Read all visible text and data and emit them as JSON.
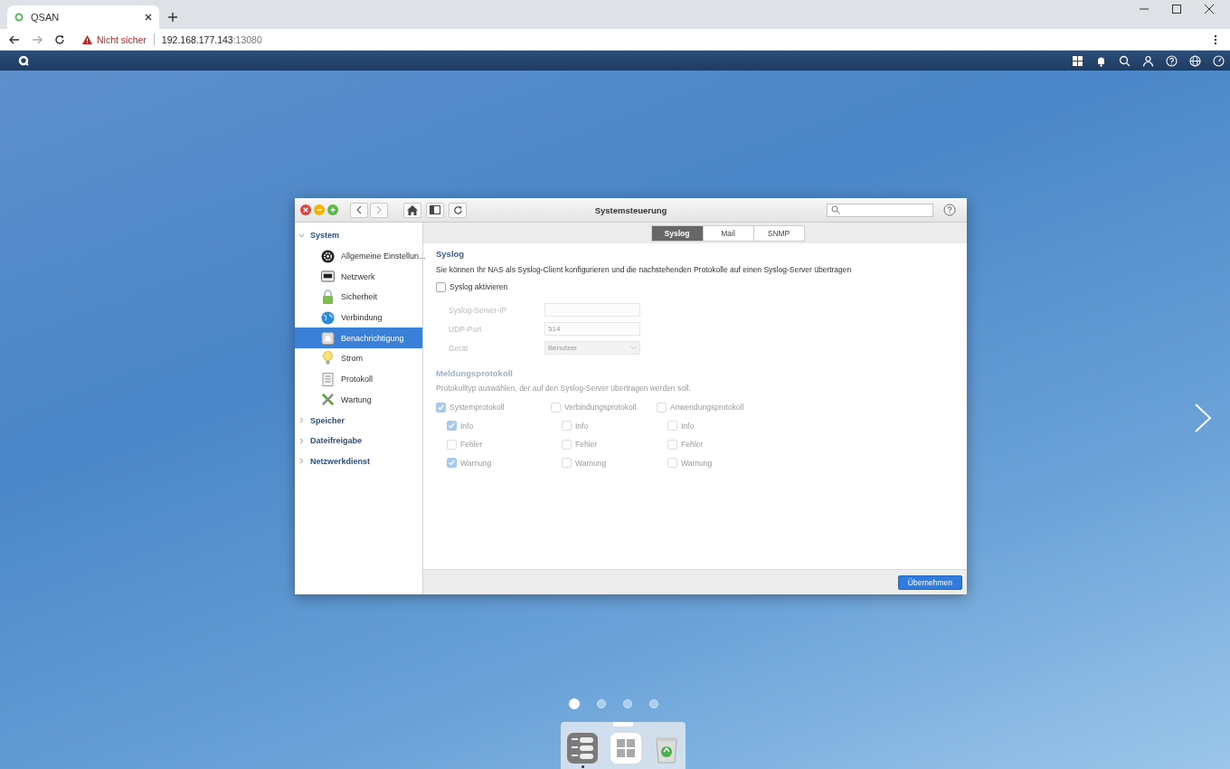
{
  "browser": {
    "tab_title": "QSAN",
    "security": "Nicht sicher",
    "url_host": "192.168.177.143",
    "url_port": ":13080"
  },
  "window": {
    "title": "Systemsteuerung"
  },
  "sidebar": {
    "groups": [
      {
        "label": "System",
        "expanded": true,
        "children": [
          {
            "label": "Allgemeine Einstellun...",
            "kind": "gear",
            "selected": false
          },
          {
            "label": "Netzwerk",
            "kind": "network",
            "selected": false
          },
          {
            "label": "Sicherheit",
            "kind": "lock",
            "selected": false
          },
          {
            "label": "Verbindung",
            "kind": "globe",
            "selected": false
          },
          {
            "label": "Benachrichtigung",
            "kind": "bell",
            "selected": true
          },
          {
            "label": "Strom",
            "kind": "bulb",
            "selected": false
          },
          {
            "label": "Protokoll",
            "kind": "log",
            "selected": false
          },
          {
            "label": "Wartung",
            "kind": "tools",
            "selected": false
          }
        ]
      },
      {
        "label": "Speicher",
        "expanded": false
      },
      {
        "label": "Dateifreigabe",
        "expanded": false
      },
      {
        "label": "Netzwerkdienst",
        "expanded": false
      }
    ]
  },
  "tabs": [
    {
      "label": "Syslog",
      "selected": true
    },
    {
      "label": "Mail",
      "selected": false
    },
    {
      "label": "SNMP",
      "selected": false
    }
  ],
  "syslog": {
    "heading": "Syslog",
    "description": "Sie können Ihr NAS als Syslog-Client konfigurieren und die nachstehenden Protokolle auf einen Syslog-Server übertragen",
    "enable": {
      "label": "Syslog aktivieren",
      "checked": false
    },
    "fields": [
      {
        "label": "Syslog-Server-IP",
        "kind": "text",
        "disabled": true
      },
      {
        "label": "UDP-Port",
        "kind": "text",
        "value": "514",
        "disabled": true
      },
      {
        "label": "Gerät",
        "kind": "select",
        "value": "Benutzer",
        "disabled": true
      }
    ]
  },
  "message_log": {
    "heading": "Meldungsprotokoll",
    "description": "Protokolltyp auswählen, der auf den Syslog-Server übertragen werden soll.",
    "disabled": true,
    "columns": [
      {
        "label": "Systemprotokoll",
        "checked": true,
        "items": [
          {
            "label": "Info",
            "checked": true
          },
          {
            "label": "Fehler",
            "checked": false
          },
          {
            "label": "Warnung",
            "checked": true
          }
        ]
      },
      {
        "label": "Verbindungsprotokoll",
        "checked": false,
        "items": [
          {
            "label": "Info",
            "checked": false
          },
          {
            "label": "Fehler",
            "checked": false
          },
          {
            "label": "Warnung",
            "checked": false
          }
        ]
      },
      {
        "label": "Anwendungsprotokoll",
        "checked": false,
        "items": [
          {
            "label": "Info",
            "checked": false
          },
          {
            "label": "Fehler",
            "checked": false
          },
          {
            "label": "Warnung",
            "checked": false
          }
        ]
      }
    ]
  },
  "apply_button": "Übernehmen",
  "pager": [
    {
      "selected": true
    },
    {
      "selected": false
    },
    {
      "selected": false
    },
    {
      "selected": false
    }
  ],
  "dock": [
    {
      "kind": "control-panel",
      "running": true
    },
    {
      "kind": "apps",
      "running": false
    },
    {
      "kind": "trash",
      "running": false
    }
  ]
}
